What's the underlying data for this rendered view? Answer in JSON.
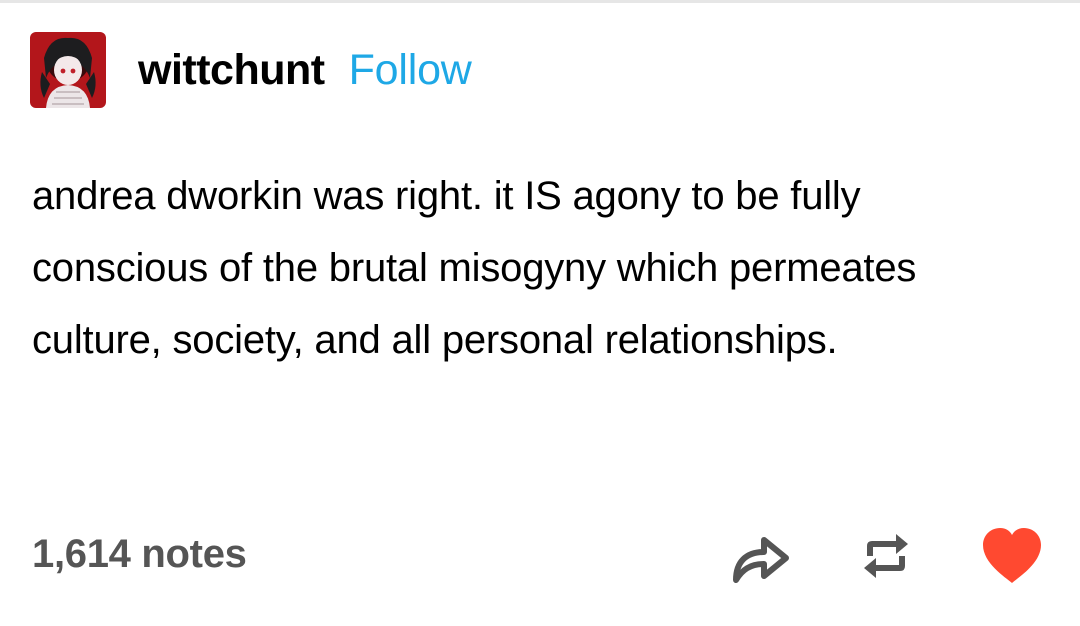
{
  "post": {
    "blog_name": "wittchunt",
    "follow_label": "Follow",
    "body": "andrea dworkin was right. it IS agony to be fully conscious of the brutal misogyny which permeates culture, society, and all personal relationships.",
    "notes": "1,614 notes"
  },
  "icons": {
    "avatar": "avatar",
    "share": "share-arrow-icon",
    "reblog": "reblog-icon",
    "like": "heart-icon"
  },
  "colors": {
    "follow": "#1ea8e6",
    "notes": "#555555",
    "icons": "#555555",
    "like": "#ff4930",
    "avatar_bg": "#b3161b"
  }
}
